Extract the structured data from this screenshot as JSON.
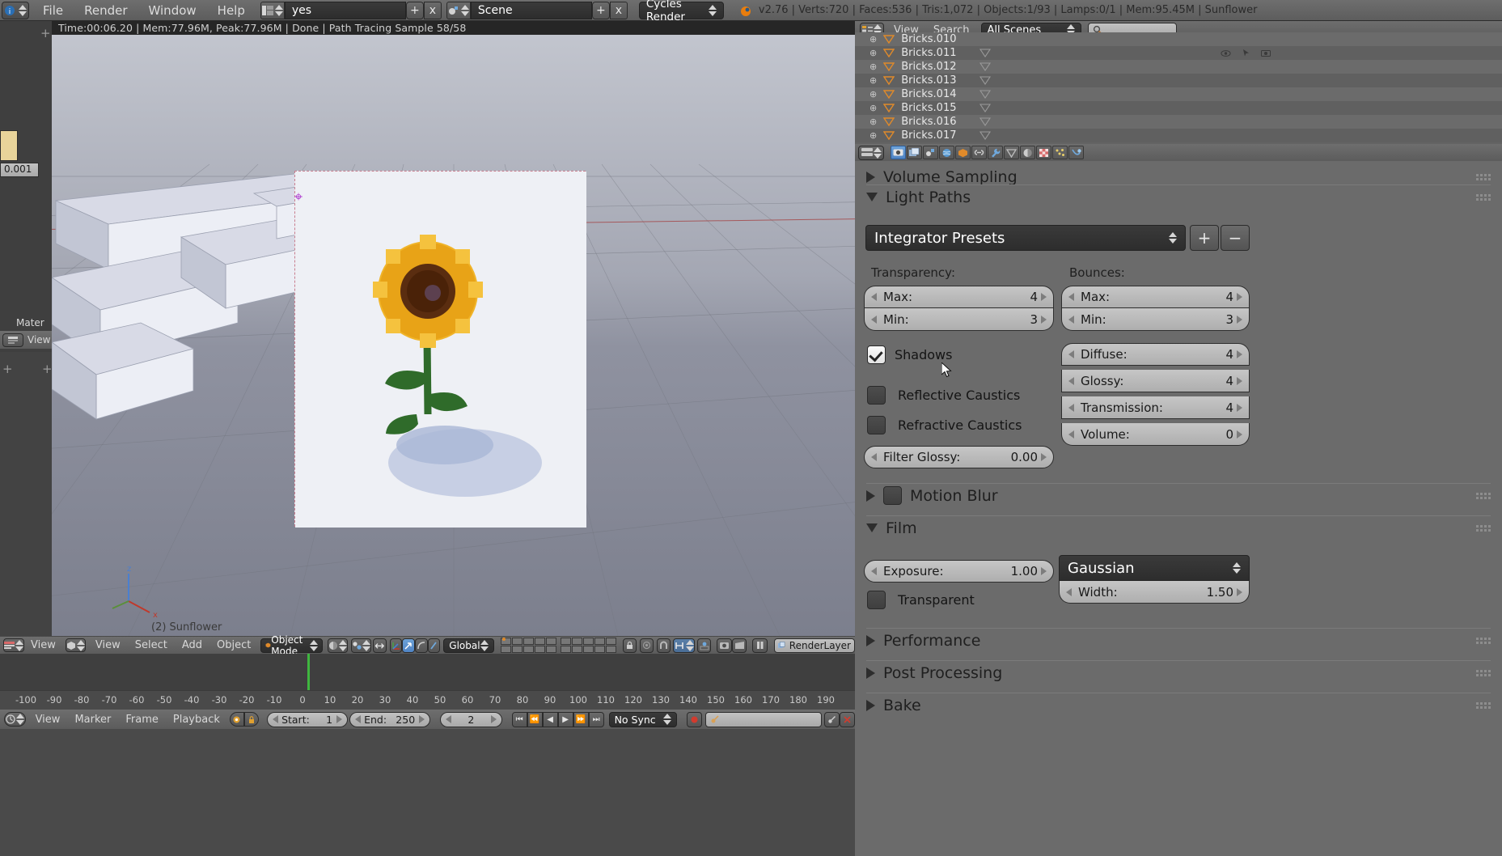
{
  "app": {
    "version": "v2.76"
  },
  "topbar": {
    "icon": "blender-logo-icon",
    "menus": [
      "File",
      "Render",
      "Window",
      "Help"
    ],
    "screen": {
      "icon": "screen-layout-icon",
      "value": "yes",
      "add": "+",
      "remove": "x"
    },
    "scene": {
      "icon": "scene-icon",
      "value": "Scene",
      "add": "+",
      "remove": "x"
    },
    "engine": {
      "value": "Cycles Render"
    },
    "stats": "v2.76 | Verts:720 | Faces:536 | Tris:1,072 | Objects:1/93 | Lamps:0/1 | Mem:95.45M | Sunflower"
  },
  "render_info": "Time:00:06.20 | Mem:77.96M, Peak:77.96M | Done | Path Tracing Sample 58/58",
  "viewport": {
    "active_object_label": "(2) Sunflower",
    "footer": {
      "editor_icon": "editor-type-icon",
      "first_view": "View",
      "mode_icon": "object-mode-icon",
      "menus": [
        "View",
        "Select",
        "Add",
        "Object"
      ],
      "mode": "Object Mode",
      "shading": "solid-shading-icon",
      "pivot": "pivot-icon",
      "manipulator_toggle": "manipulator-icon",
      "manipulators": [
        "translate-manipulator-icon",
        "rotate-manipulator-icon",
        "scale-manipulator-icon"
      ],
      "orientation": "Global",
      "layers": "scene-layers-grid",
      "lock_icon": "lock-icon",
      "proportional_icon": "proportional-edit-icon",
      "snap_icon": "magnet-icon",
      "snap_target": "snap-target-icon",
      "snap_element": "snap-element-icon",
      "render_icons": [
        "render-opengl-image-icon",
        "render-opengl-anim-icon"
      ],
      "pause_icon": "pause-icon",
      "render_layer_icon": "renderlayers-icon",
      "render_layer": "RenderLayer"
    }
  },
  "timeline": {
    "ticks": [
      "-100",
      "-90",
      "-80",
      "-70",
      "-60",
      "-50",
      "-40",
      "-30",
      "-20",
      "-10",
      "0",
      "10",
      "20",
      "30",
      "40",
      "50",
      "60",
      "70",
      "80",
      "90",
      "100",
      "110",
      "120",
      "130",
      "140",
      "150",
      "160",
      "170",
      "180",
      "190"
    ],
    "editor_icon": "timeline-editor-icon",
    "menus": [
      "View",
      "Marker",
      "Frame",
      "Playback"
    ],
    "auto_key_icon": "record-icon",
    "lock_icon": "lock-icon",
    "start_label": "Start:",
    "start_value": "1",
    "end_label": "End:",
    "end_value": "250",
    "current_frame": "2",
    "transport": [
      "jump-start-icon",
      "prev-keyframe-icon",
      "play-reverse-icon",
      "play-icon",
      "next-keyframe-icon",
      "jump-end-icon"
    ],
    "sync": "No Sync",
    "record_icon": "record-dot-icon",
    "keying_set_icon": "keyingset-icon",
    "keying_set_value": "",
    "add_keyingset_icon": "add-keyingset-icon",
    "remove_keyingset_icon": "remove-keyingset-icon",
    "playhead_frame": "2"
  },
  "outliner": {
    "editor_icon": "outliner-editor-icon",
    "menus": [
      "View",
      "Search"
    ],
    "scope": "All Scenes",
    "search_icon": "search-icon",
    "search_value": "",
    "rows": [
      {
        "name": "Bricks.010",
        "expand": "expand-icon",
        "type_icon": "mesh-data-icon",
        "clipped": true
      },
      {
        "name": "Bricks.011",
        "expand": "expand-icon",
        "type_icon": "mesh-data-icon",
        "clipped": false
      },
      {
        "name": "Bricks.012",
        "expand": "expand-icon",
        "type_icon": "mesh-data-icon",
        "clipped": false
      },
      {
        "name": "Bricks.013",
        "expand": "expand-icon",
        "type_icon": "mesh-data-icon",
        "clipped": false
      },
      {
        "name": "Bricks.014",
        "expand": "expand-icon",
        "type_icon": "mesh-data-icon",
        "clipped": false
      },
      {
        "name": "Bricks.015",
        "expand": "expand-icon",
        "type_icon": "mesh-data-icon",
        "clipped": false
      },
      {
        "name": "Bricks.016",
        "expand": "expand-icon",
        "type_icon": "mesh-data-icon",
        "clipped": false
      },
      {
        "name": "Bricks.017",
        "expand": "expand-icon",
        "type_icon": "mesh-data-icon",
        "clipped": false
      }
    ],
    "restrict_icons": [
      "eye-icon",
      "cursor-select-icon",
      "camera-render-icon"
    ]
  },
  "properties": {
    "tabs": [
      {
        "name": "render-tab",
        "icon": "camera-back-icon",
        "active": true
      },
      {
        "name": "render-layers-tab",
        "icon": "renderlayers-icon",
        "active": false
      },
      {
        "name": "scene-tab",
        "icon": "scene-icon",
        "active": false
      },
      {
        "name": "world-tab",
        "icon": "world-icon",
        "active": false
      },
      {
        "name": "object-tab",
        "icon": "object-cube-icon",
        "active": false
      },
      {
        "name": "constraints-tab",
        "icon": "constraint-link-icon",
        "active": false
      },
      {
        "name": "modifiers-tab",
        "icon": "wrench-icon",
        "active": false
      },
      {
        "name": "data-tab",
        "icon": "mesh-data-icon",
        "active": false
      },
      {
        "name": "material-tab",
        "icon": "material-sphere-icon",
        "active": false
      },
      {
        "name": "texture-tab",
        "icon": "texture-checker-icon",
        "active": false
      },
      {
        "name": "particles-tab",
        "icon": "particles-icon",
        "active": false
      },
      {
        "name": "physics-tab",
        "icon": "physics-icon",
        "active": false
      }
    ],
    "panels": {
      "volume_sampling": {
        "label": "Volume Sampling",
        "open": false
      },
      "light_paths": {
        "label": "Light Paths",
        "open": true,
        "preset": {
          "label": "Integrator Presets",
          "add": "+",
          "remove": "-"
        },
        "transparency_label": "Transparency:",
        "bounces_label": "Bounces:",
        "transparency": [
          {
            "label": "Max:",
            "value": "4"
          },
          {
            "label": "Min:",
            "value": "3"
          }
        ],
        "bounces": [
          {
            "label": "Max:",
            "value": "4"
          },
          {
            "label": "Min:",
            "value": "3"
          },
          {
            "label": "Diffuse:",
            "value": "4"
          },
          {
            "label": "Glossy:",
            "value": "4"
          },
          {
            "label": "Transmission:",
            "value": "4"
          },
          {
            "label": "Volume:",
            "value": "0"
          }
        ],
        "checkboxes": [
          {
            "label": "Shadows",
            "checked": true
          },
          {
            "label": "Reflective Caustics",
            "checked": false
          },
          {
            "label": "Refractive Caustics",
            "checked": false
          }
        ],
        "filter_glossy": {
          "label": "Filter Glossy:",
          "value": "0.00"
        }
      },
      "motion_blur": {
        "label": "Motion Blur",
        "open": false,
        "checked": false
      },
      "film": {
        "label": "Film",
        "open": true,
        "exposure": {
          "label": "Exposure:",
          "value": "1.00"
        },
        "transparent": {
          "label": "Transparent",
          "checked": false
        },
        "filter_type": "Gaussian",
        "width": {
          "label": "Width:",
          "value": "1.50"
        }
      },
      "performance": {
        "label": "Performance",
        "open": false
      },
      "post_processing": {
        "label": "Post Processing",
        "open": false
      },
      "bake": {
        "label": "Bake",
        "open": false
      }
    }
  }
}
